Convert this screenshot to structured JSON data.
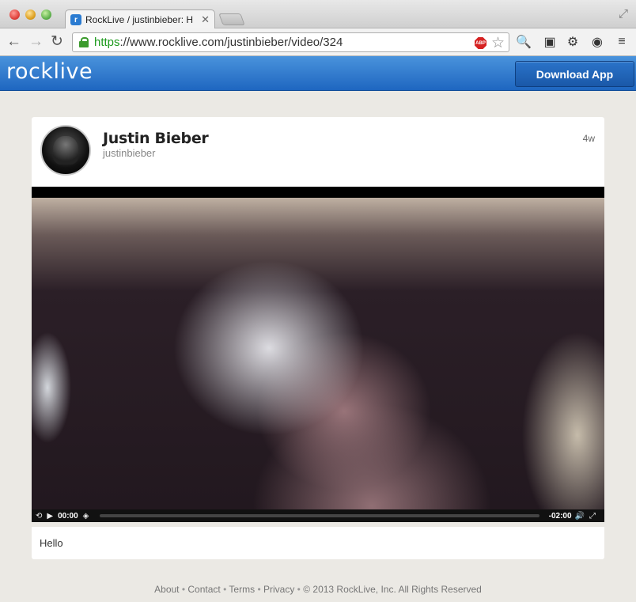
{
  "browser": {
    "tab_title": "RockLive / justinbieber: H",
    "favicon_letter": "r",
    "url_scheme": "https",
    "url_rest": "://www.rocklive.com/justinbieber/video/324",
    "abp_label": "ABP"
  },
  "site": {
    "logo": "rocklive",
    "download_button": "Download App"
  },
  "post": {
    "name": "Justin Bieber",
    "handle": "justinbieber",
    "time_ago": "4w",
    "caption": "Hello"
  },
  "player": {
    "current_time": "00:00",
    "remaining_time": "-02:00",
    "progress": 0
  },
  "footer": {
    "about": "About",
    "contact": "Contact",
    "terms": "Terms",
    "privacy": "Privacy",
    "copyright": "© 2013 RockLive, Inc. All Rights Reserved"
  }
}
